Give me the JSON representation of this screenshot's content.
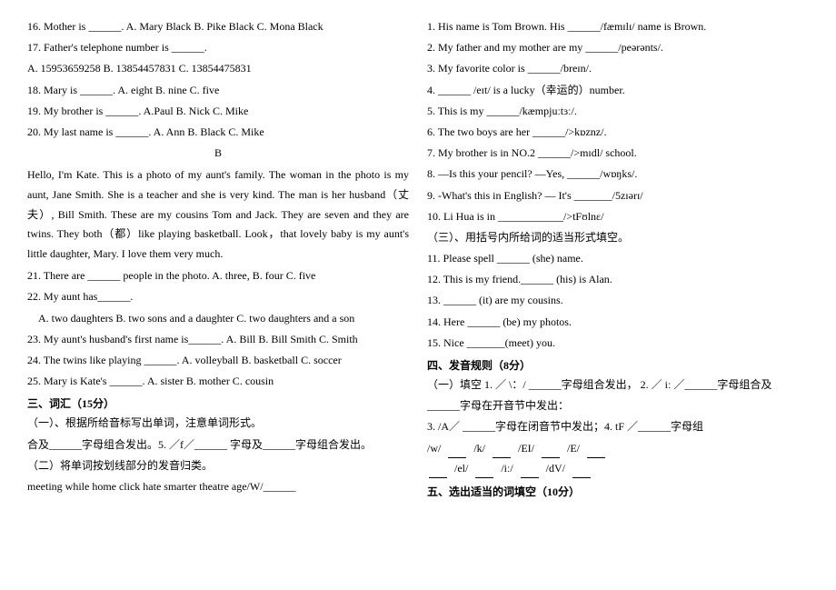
{
  "left": {
    "questions": [
      {
        "num": "16.",
        "text": "Mother is ______. A. Mary Black  B. Pike Black  C. Mona Black"
      },
      {
        "num": "17.",
        "text": "Father's telephone number is ______."
      },
      {
        "num": "A.",
        "text": "15953659258   B. 13854457831   C. 13854475831"
      },
      {
        "num": "18.",
        "text": "Mary is ______. A. eight         B. nine              C. five"
      },
      {
        "num": "19.",
        "text": "My brother is ______. A.Paul          B. Nick              C. Mike"
      },
      {
        "num": "20.",
        "text": "My last name is ______. A. Ann          B. Black             C. Mike"
      }
    ],
    "center_b": "B",
    "paragraph": "Hello, I'm Kate. This is a photo of my aunt's family. The woman in the photo is my aunt, Jane Smith. She is a teacher and she is very kind. The man is her husband（丈夫）, Bill Smith. These are my cousins Tom and Jack. They are seven and they are twins. They both（都）like playing basketball. Look，that lovely baby is my aunt's little daughter, Mary. I love them very much.",
    "q21": {
      "num": "21.",
      "text": "There are ______ people in the photo. A. three,  B. four   C. five"
    },
    "q22": {
      "num": "22.",
      "text": "My aunt has______."
    },
    "q22_options": "A. two daughters   B. two sons and a daughter   C. two daughters and a son",
    "q23": {
      "num": "23.",
      "text": "My aunt's husband's first name is______. A. Bill   B. Bill Smith   C. Smith"
    },
    "q24": {
      "num": "24.",
      "text": "The twins like playing ______. A. volleyball   B. basketball  C. soccer"
    },
    "q25": {
      "num": "25.",
      "text": "Mary is Kate's ______. A. sister   B. mother   C. cousin"
    },
    "section3_title": "三、词汇（15分）",
    "section3_sub1": "（一）、根据所给音标写出单词，注意单词形式。",
    "section3_line1": "合及______字母组合发出。5. ／f／______  字母及______字母组合发出。",
    "section3_sub2": "（二）将单词按划线部分的发音归类。",
    "section3_words": "meeting  while   home   click   hate   smarter   theatre   age/W/______"
  },
  "right": {
    "q1": "1. His name is Tom Brown. His ______/fæmɪlɪ/ name is Brown.",
    "q2": "2. My father and my mother are my ______/peərənts/.",
    "q3": "3. My favorite color is ______/breɪn/.",
    "q4": "4. ______ /eɪt/ is a lucky（幸运的）number.",
    "q5": "5. This is my ______/kæmpjuːtɜː/.",
    "q6": "6. The two boys are her ______/>kɒznz/.",
    "q7": "7. My brother is in NO.2 ______/>mɪdl/ school.",
    "q8": "8. —Is this your pencil? —Yes, ______/wɒŋks/.",
    "q9": "9. -What's this in English? — It's _______/5zɪərɪ/",
    "q10": "10. Li Hua is in ____________/>tFʊlnɛ/",
    "q10_note": "（三）、用括号内所给词的适当形式填空。",
    "q11": "11. Please spell ______ (she) name.",
    "q12": "12. This is my friend.______ (his) is Alan.",
    "q13": "13. ______ (it) are my cousins.",
    "q14": "14. Here ______ (be) my photos.",
    "q15": "15. Nice _______(meet) you.",
    "section4_title": "四、发音规则（8分）",
    "section4_sub1": "（一）填空 1. ／ \\：/ ______字母组合发出，   2. ／ iː ／______字母组合及",
    "section4_sub1_cont": "______字母在开音节中发出：",
    "section4_sub2": "3. /A／  ______字母在闭音节中发出；4.  tF ／______字母组",
    "phonetics": [
      "/w/",
      "",
      "/k/",
      "",
      "/EI/",
      "",
      "/E/",
      "",
      "",
      "/el/",
      "",
      "/iː/",
      "",
      "/dV/",
      ""
    ],
    "section5_title": "五、选出适当的词填空（10分）"
  }
}
